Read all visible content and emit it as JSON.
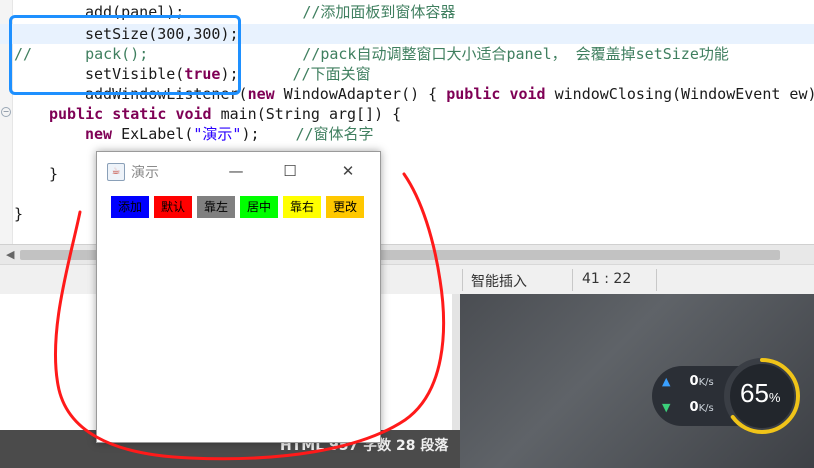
{
  "editor": {
    "lines": {
      "l1": "add(panel);",
      "l1_comment": "//添加面板到窗体容器",
      "l2": "setSize(300,300);",
      "l3_comment_prefix": "//",
      "l3": "pack();",
      "l3_comment": "//pack自动调整窗口大小适合panel， 会覆盖掉setSize功能",
      "l4_call": "setVisible(",
      "l4_kw": "true",
      "l4_end": ");",
      "l4_comment": "//下面关窗",
      "l5_pre": "addWindowListener(",
      "l5_new": "new",
      "l5_mid": " WindowAdapter() {",
      "l5_kw1": "public",
      "l5_kw2": "void",
      "l5_rest": " windowClosing(WindowEvent ew)",
      "l6_kw1": "public",
      "l6_kw2": "static",
      "l6_kw3": "void",
      "l6_rest": " main(String arg[]) {",
      "l7_new": "new",
      "l7_class": " ExLabel(",
      "l7_str": "\"演示\"",
      "l7_end": ");",
      "l7_comment": "//窗体名字",
      "l8": "}",
      "l9": "}"
    }
  },
  "statusbar": {
    "insert_mode": "智能插入",
    "cursor_pos": "41 : 22"
  },
  "footer": {
    "text": "HTML   957 字数   28 段落"
  },
  "net_monitor": {
    "upload_value": "0",
    "download_value": "0",
    "unit": "K/s",
    "gauge_value": "65",
    "gauge_unit": "%",
    "gauge_fraction": 0.65
  },
  "jframe": {
    "title": "演示",
    "minimize_glyph": "—",
    "maximize_glyph": "☐",
    "close_glyph": "✕",
    "labels": [
      {
        "text": "添加",
        "bg": "#0000ff"
      },
      {
        "text": "默认",
        "bg": "#ff0000"
      },
      {
        "text": "靠左",
        "bg": "#808080"
      },
      {
        "text": "居中",
        "bg": "#00ff00"
      },
      {
        "text": "靠右",
        "bg": "#ffff00"
      },
      {
        "text": "更改",
        "bg": "#ffc800"
      }
    ]
  },
  "colors": {
    "callout_border": "#1e90ff",
    "annotation_red": "#ff1a1a",
    "keyword": "#7f0055",
    "comment": "#3f7f5f",
    "string": "#2a00ff"
  }
}
